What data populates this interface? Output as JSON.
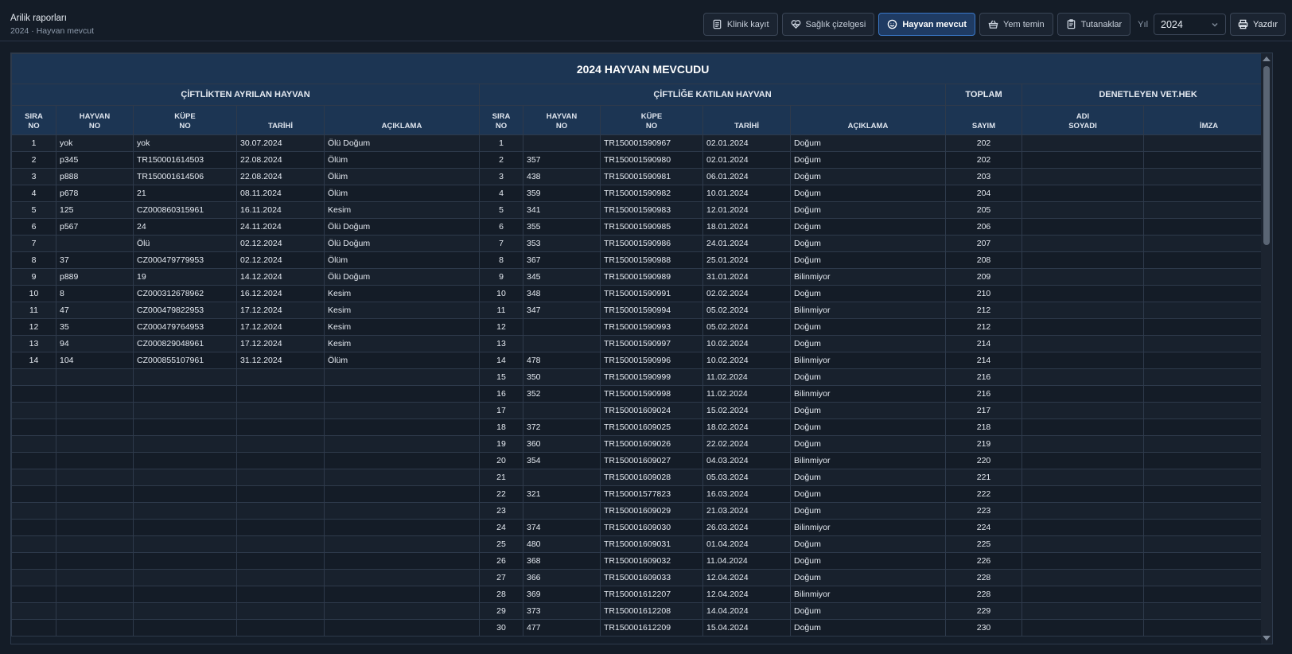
{
  "header": {
    "title": "Arilik raporları",
    "subtitle": "2024 · Hayvan mevcut"
  },
  "toolbar": {
    "buttons": [
      {
        "label": "Klinik kayıt",
        "icon": "document-icon",
        "active": false
      },
      {
        "label": "Sağlık çizelgesi",
        "icon": "heart-pulse-icon",
        "active": false
      },
      {
        "label": "Hayvan mevcut",
        "icon": "smiley-icon",
        "active": true
      },
      {
        "label": "Yem temin",
        "icon": "basket-icon",
        "active": false
      },
      {
        "label": "Tutanaklar",
        "icon": "clipboard-icon",
        "active": false
      }
    ],
    "year_label": "Yıl",
    "year_value": "2024",
    "print_label": "Yazdır"
  },
  "table": {
    "title": "2024 HAYVAN MEVCUDU",
    "groups": {
      "left": "ÇİFTLİKTEN AYRILAN HAYVAN",
      "right": "ÇİFTLİĞE KATILAN HAYVAN",
      "total": "TOPLAM",
      "vet": "DENETLEYEN VET.HEK"
    },
    "columns": {
      "sira": [
        "SIRA",
        "NO"
      ],
      "hayvan": [
        "HAYVAN",
        "NO"
      ],
      "kupe": [
        "KÜPE",
        "NO"
      ],
      "tarih": "TARİHİ",
      "aciklama": "AÇIKLAMA",
      "sayim": "SAYIM",
      "adi": [
        "ADI",
        "SOYADI"
      ],
      "imza": "İMZA"
    },
    "left_rows": [
      [
        "1",
        "yok",
        "yok",
        "30.07.2024",
        "Ölü Doğum"
      ],
      [
        "2",
        "p345",
        "TR150001614503",
        "22.08.2024",
        "Ölüm"
      ],
      [
        "3",
        "p888",
        "TR150001614506",
        "22.08.2024",
        "Ölüm"
      ],
      [
        "4",
        "p678",
        "21",
        "08.11.2024",
        "Ölüm"
      ],
      [
        "5",
        "125",
        "CZ000860315961",
        "16.11.2024",
        "Kesim"
      ],
      [
        "6",
        "p567",
        "24",
        "24.11.2024",
        "Ölü Doğum"
      ],
      [
        "7",
        "",
        "Ölü",
        "02.12.2024",
        "Ölü Doğum"
      ],
      [
        "8",
        "37",
        "CZ000479779953",
        "02.12.2024",
        "Ölüm"
      ],
      [
        "9",
        "p889",
        "19",
        "14.12.2024",
        "Ölü Doğum"
      ],
      [
        "10",
        "8",
        "CZ000312678962",
        "16.12.2024",
        "Kesim"
      ],
      [
        "11",
        "47",
        "CZ000479822953",
        "17.12.2024",
        "Kesim"
      ],
      [
        "12",
        "35",
        "CZ000479764953",
        "17.12.2024",
        "Kesim"
      ],
      [
        "13",
        "94",
        "CZ000829048961",
        "17.12.2024",
        "Kesim"
      ],
      [
        "14",
        "104",
        "CZ000855107961",
        "31.12.2024",
        "Ölüm"
      ]
    ],
    "right_rows": [
      [
        "1",
        "",
        "TR150001590967",
        "02.01.2024",
        "Doğum",
        "202"
      ],
      [
        "2",
        "357",
        "TR150001590980",
        "02.01.2024",
        "Doğum",
        "202"
      ],
      [
        "3",
        "438",
        "TR150001590981",
        "06.01.2024",
        "Doğum",
        "203"
      ],
      [
        "4",
        "359",
        "TR150001590982",
        "10.01.2024",
        "Doğum",
        "204"
      ],
      [
        "5",
        "341",
        "TR150001590983",
        "12.01.2024",
        "Doğum",
        "205"
      ],
      [
        "6",
        "355",
        "TR150001590985",
        "18.01.2024",
        "Doğum",
        "206"
      ],
      [
        "7",
        "353",
        "TR150001590986",
        "24.01.2024",
        "Doğum",
        "207"
      ],
      [
        "8",
        "367",
        "TR150001590988",
        "25.01.2024",
        "Doğum",
        "208"
      ],
      [
        "9",
        "345",
        "TR150001590989",
        "31.01.2024",
        "Bilinmiyor",
        "209"
      ],
      [
        "10",
        "348",
        "TR150001590991",
        "02.02.2024",
        "Doğum",
        "210"
      ],
      [
        "11",
        "347",
        "TR150001590994",
        "05.02.2024",
        "Bilinmiyor",
        "212"
      ],
      [
        "12",
        "",
        "TR150001590993",
        "05.02.2024",
        "Doğum",
        "212"
      ],
      [
        "13",
        "",
        "TR150001590997",
        "10.02.2024",
        "Doğum",
        "214"
      ],
      [
        "14",
        "478",
        "TR150001590996",
        "10.02.2024",
        "Bilinmiyor",
        "214"
      ],
      [
        "15",
        "350",
        "TR150001590999",
        "11.02.2024",
        "Doğum",
        "216"
      ],
      [
        "16",
        "352",
        "TR150001590998",
        "11.02.2024",
        "Bilinmiyor",
        "216"
      ],
      [
        "17",
        "",
        "TR150001609024",
        "15.02.2024",
        "Doğum",
        "217"
      ],
      [
        "18",
        "372",
        "TR150001609025",
        "18.02.2024",
        "Doğum",
        "218"
      ],
      [
        "19",
        "360",
        "TR150001609026",
        "22.02.2024",
        "Doğum",
        "219"
      ],
      [
        "20",
        "354",
        "TR150001609027",
        "04.03.2024",
        "Bilinmiyor",
        "220"
      ],
      [
        "21",
        "",
        "TR150001609028",
        "05.03.2024",
        "Doğum",
        "221"
      ],
      [
        "22",
        "321",
        "TR150001577823",
        "16.03.2024",
        "Doğum",
        "222"
      ],
      [
        "23",
        "",
        "TR150001609029",
        "21.03.2024",
        "Doğum",
        "223"
      ],
      [
        "24",
        "374",
        "TR150001609030",
        "26.03.2024",
        "Bilinmiyor",
        "224"
      ],
      [
        "25",
        "480",
        "TR150001609031",
        "01.04.2024",
        "Doğum",
        "225"
      ],
      [
        "26",
        "368",
        "TR150001609032",
        "11.04.2024",
        "Doğum",
        "226"
      ],
      [
        "27",
        "366",
        "TR150001609033",
        "12.04.2024",
        "Doğum",
        "228"
      ],
      [
        "28",
        "369",
        "TR150001612207",
        "12.04.2024",
        "Bilinmiyor",
        "228"
      ],
      [
        "29",
        "373",
        "TR150001612208",
        "14.04.2024",
        "Doğum",
        "229"
      ],
      [
        "30",
        "477",
        "TR150001612209",
        "15.04.2024",
        "Doğum",
        "230"
      ]
    ]
  },
  "colors": {
    "background": "#141c27",
    "header_fill": "#1c3553",
    "accent": "#3a78c8"
  }
}
